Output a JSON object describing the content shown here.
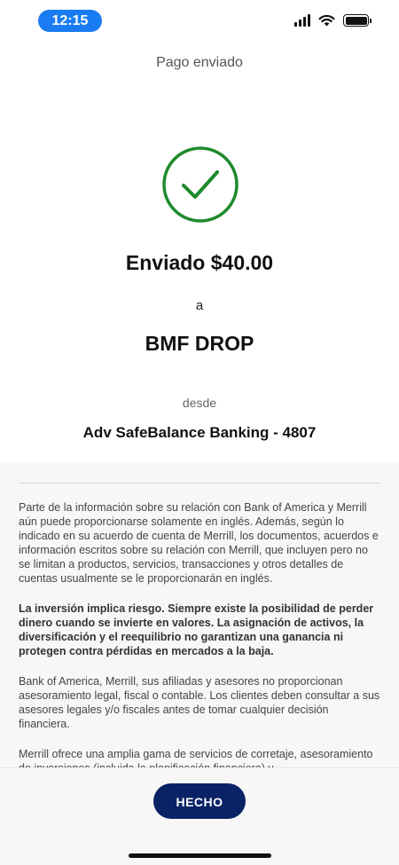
{
  "status_bar": {
    "time": "12:15",
    "icons": [
      "signal-icon",
      "wifi-icon",
      "battery-icon"
    ]
  },
  "header": {
    "title": "Pago enviado"
  },
  "confirmation": {
    "icon": "checkmark-circle-icon",
    "icon_color": "#1e8a2c",
    "sent_label": "Enviado $40.00",
    "to_word": "a",
    "recipient": "BMF DROP",
    "from_word": "desde",
    "account": "Adv SafeBalance Banking - 4807"
  },
  "disclosures": {
    "p1": "Parte de la información sobre su relación con Bank of America y Merrill aún puede proporcionarse solamente en inglés. Además, según lo indicado en su acuerdo de cuenta de Merrill, los documentos, acuerdos e información escritos sobre su relación con Merrill, que incluyen pero no se limitan a productos, servicios, transacciones y otros detalles de cuentas usualmente se le proporcionarán en inglés.",
    "p2": "La inversión implica riesgo. Siempre existe la posibilidad de perder dinero cuando se invierte en valores. La asignación de activos, la diversificación y el reequilibrio no garantizan una ganancia ni protegen contra pérdidas en mercados a la baja.",
    "p3": "Bank of America, Merrill, sus afiliadas y asesores no proporcionan asesoramiento legal, fiscal o contable. Los clientes deben consultar a sus asesores legales y/o fiscales antes de tomar cualquier decisión financiera.",
    "p4": "Merrill ofrece una amplia gama de servicios de corretaje, asesoramiento de inversiones (incluida la planificación financiera) y"
  },
  "footer": {
    "done_label": "HECHO",
    "button_color": "#0a2266"
  }
}
